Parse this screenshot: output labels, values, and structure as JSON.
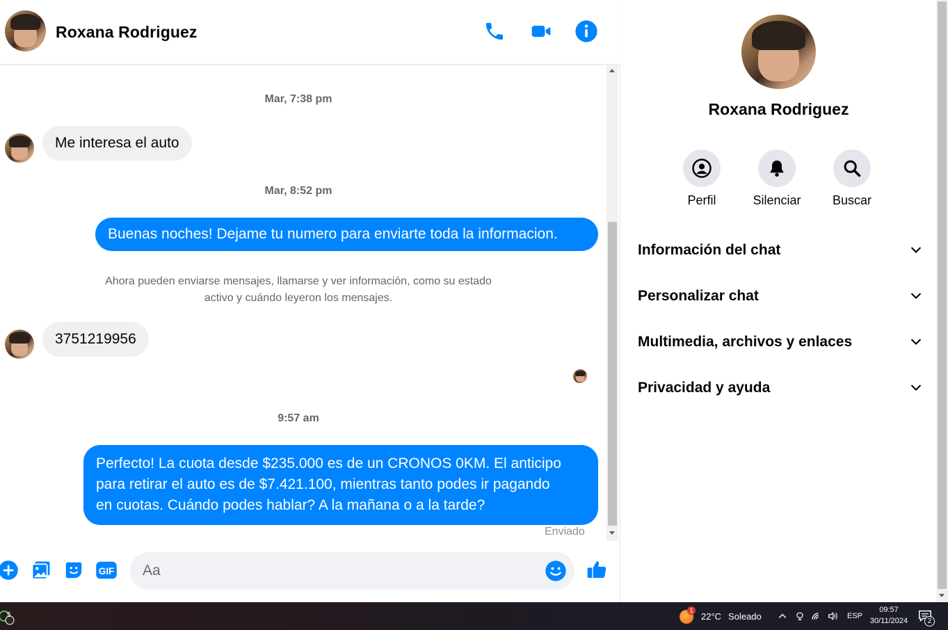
{
  "header": {
    "contact_name": "Roxana Rodriguez",
    "icons": [
      "phone-icon",
      "video-icon",
      "info-icon"
    ]
  },
  "accent_color": "#0084ff",
  "messages": {
    "timestamp_1": "Mar, 7:38 pm",
    "incoming_1": "Me interesa el auto",
    "timestamp_2": "Mar, 8:52 pm",
    "outgoing_1": "Buenas noches! Dejame tu numero para enviarte toda la informacion.",
    "system_note_line1": "Ahora pueden enviarse mensajes, llamarse y ver información, como su estado",
    "system_note_line2": "activo y cuándo leyeron los mensajes.",
    "incoming_2": "3751219956",
    "timestamp_3": "9:57 am",
    "outgoing_2_line1": "Perfecto! La cuota desde $235.000 es de un CRONOS 0KM. El anticipo",
    "outgoing_2_line2": "para retirar el auto es de $7.421.100, mientras tanto podes ir pagando",
    "outgoing_2_line3": "en cuotas. Cuándo podes hablar? A la mañana o a la tarde?",
    "status": "Enviado"
  },
  "composer": {
    "placeholder": "Aa",
    "icons": [
      "plus-icon",
      "image-icon",
      "sticker-icon",
      "gif-icon",
      "emoji-icon",
      "thumbs-up-icon"
    ],
    "gif_label": "GIF"
  },
  "info_panel": {
    "name": "Roxana Rodriguez",
    "actions": [
      {
        "label": "Perfil",
        "icon": "profile-icon"
      },
      {
        "label": "Silenciar",
        "icon": "bell-icon"
      },
      {
        "label": "Buscar",
        "icon": "search-icon"
      }
    ],
    "sections": [
      {
        "title": "Información del chat"
      },
      {
        "title": "Personalizar chat"
      },
      {
        "title": "Multimedia, archivos y enlaces"
      },
      {
        "title": "Privacidad y ayuda"
      }
    ]
  },
  "taskbar": {
    "app_badge": "5",
    "weather_alert": "1",
    "weather": "22°C",
    "weather_desc": "Soleado",
    "language": "ESP",
    "time": "09:57",
    "date": "30/11/2024",
    "notifications": "2"
  }
}
